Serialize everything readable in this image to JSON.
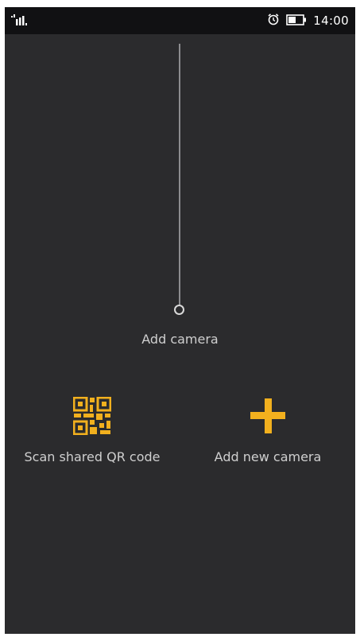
{
  "status_bar": {
    "time": "14:00",
    "icons": [
      "signal-icon",
      "alarm-icon",
      "battery-icon"
    ]
  },
  "main": {
    "title": "Add camera",
    "options": [
      {
        "label": "Scan shared QR code",
        "icon": "qr-code-icon"
      },
      {
        "label": "Add new camera",
        "icon": "plus-icon"
      }
    ]
  },
  "colors": {
    "background": "#2b2b2d",
    "status_bar": "#111113",
    "accent": "#f2b01e",
    "text": "#cfcfcf"
  }
}
